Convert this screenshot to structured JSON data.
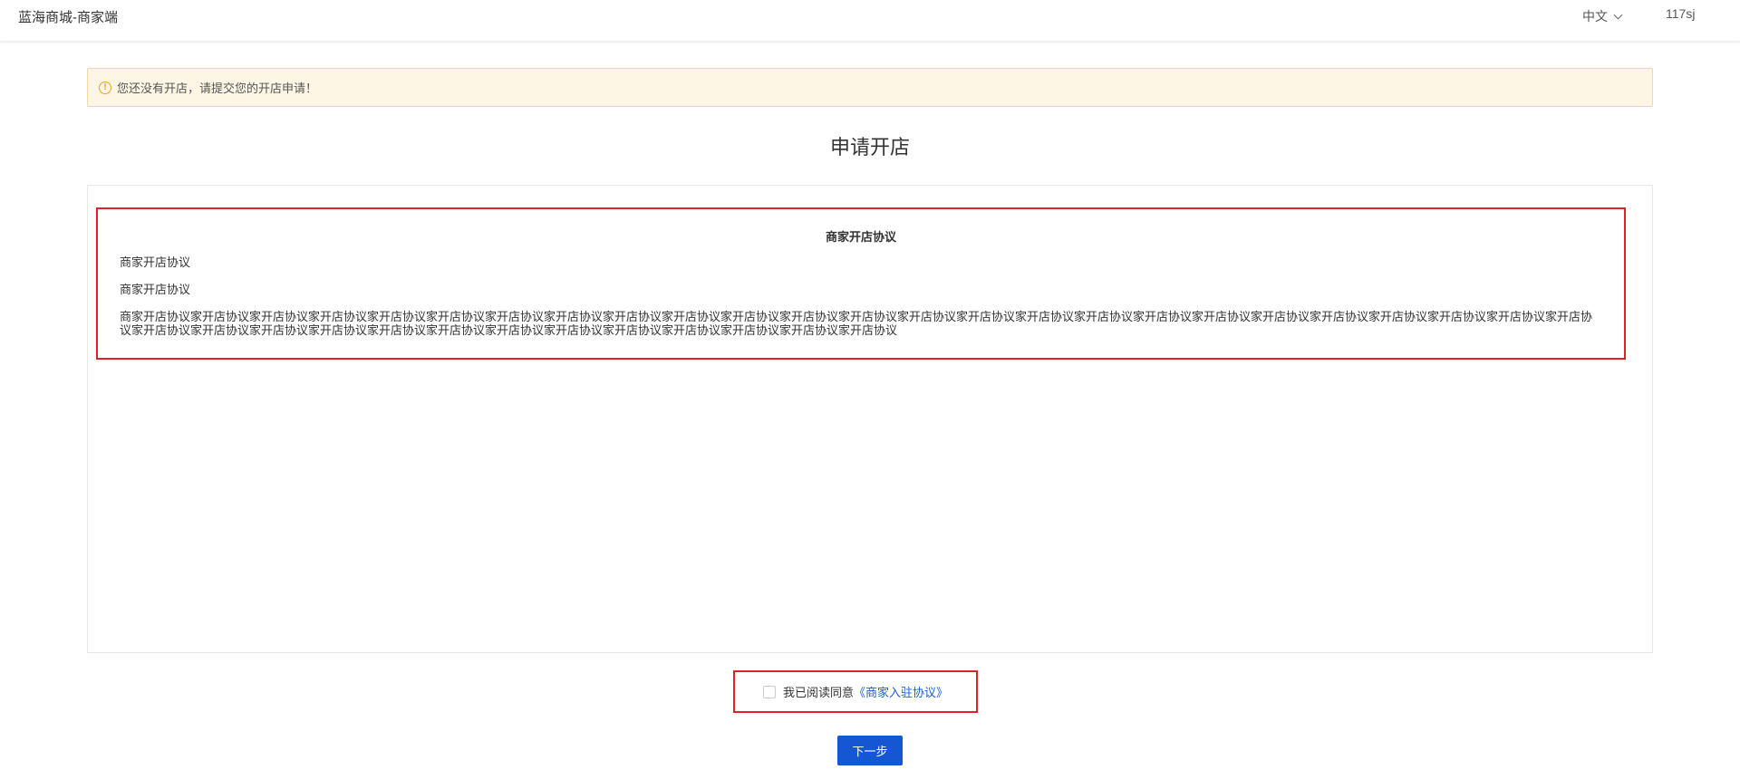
{
  "header": {
    "app_title": "蓝海商城-商家端",
    "language": "中文",
    "username": "117sj"
  },
  "alert": {
    "icon": "warning-icon",
    "icon_glyph": "!",
    "message": "您还没有开店，请提交您的开店申请！"
  },
  "page": {
    "title": "申请开店"
  },
  "agreement": {
    "heading": "商家开店协议",
    "paragraphs": [
      "商家开店协议",
      "商家开店协议",
      "商家开店协议家开店协议家开店协议家开店协议家开店协议家开店协议家开店协议家开店协议家开店协议家开店协议家开店协议家开店协议家开店协议家开店协议家开店协议家开店协议家开店协议家开店协议家开店协议家开店协议家开店协议家开店协议家开店协议家开店协议家开店协议家开店协议家开店协议家开店协议家开店协议家开店协议家开店协议家开店协议家开店协议家开店协议家开店协议家开店协议家开店协议家开店协议"
    ]
  },
  "agree": {
    "checked": false,
    "label": "我已阅读同意",
    "link_text": "《商家入驻协议》"
  },
  "actions": {
    "next_label": "下一步"
  },
  "colors": {
    "primary": "#1556d3",
    "link": "#1a5fd4",
    "alert_bg": "#fdf6e4",
    "alert_border": "#f5d99a",
    "highlight_border": "#e0202a"
  }
}
